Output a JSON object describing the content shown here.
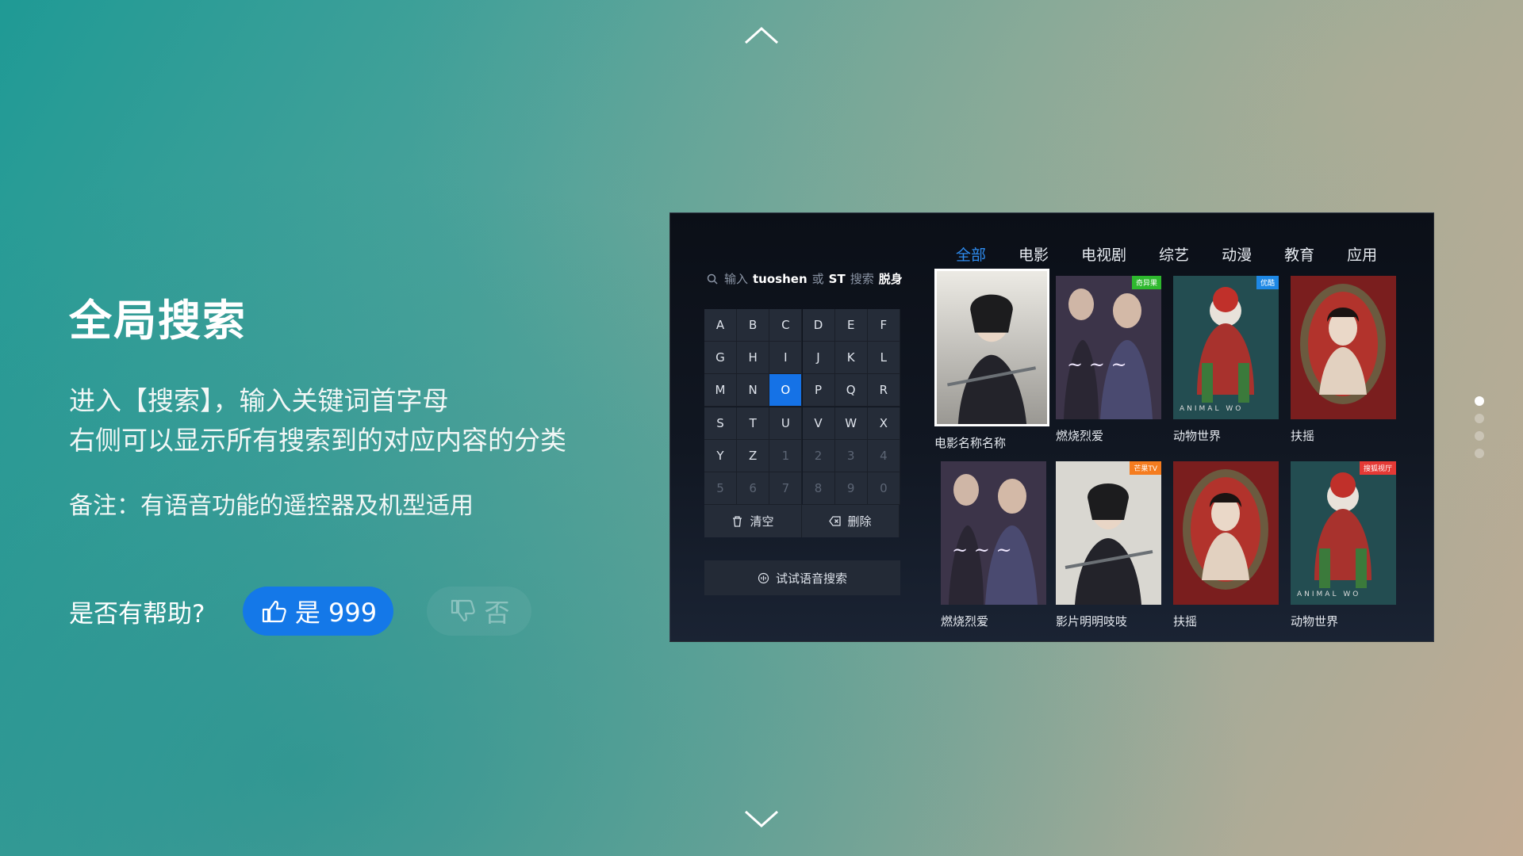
{
  "nav": {
    "up_icon": "chevron-up-icon",
    "down_icon": "chevron-down-icon"
  },
  "feature": {
    "title": "全局搜索",
    "desc_line1": "进入【搜索】，输入关键词首字母",
    "desc_line2": "右侧可以显示所有搜索到的对应内容的分类",
    "note": "备注：有语音功能的遥控器及机型适用"
  },
  "feedback": {
    "question": "是否有帮助?",
    "yes_label": "是 999",
    "no_label": "否"
  },
  "screen": {
    "tabs": [
      "全部",
      "电影",
      "电视剧",
      "综艺",
      "动漫",
      "教育",
      "应用"
    ],
    "search": {
      "hint1": "输入",
      "kw1": "tuoshen",
      "or": "或",
      "kw2": "ST",
      "hint2": "搜索",
      "target": "脱身"
    },
    "keyboard": [
      [
        "A",
        "B",
        "C",
        "D",
        "E",
        "F"
      ],
      [
        "G",
        "H",
        "I",
        "J",
        "K",
        "L"
      ],
      [
        "M",
        "N",
        "O",
        "P",
        "Q",
        "R"
      ],
      [
        "S",
        "T",
        "U",
        "V",
        "W",
        "X"
      ],
      [
        "Y",
        "Z",
        "1",
        "2",
        "3",
        "4"
      ],
      [
        "5",
        "6",
        "7",
        "8",
        "9",
        "0"
      ]
    ],
    "clear_label": "清空",
    "delete_label": "删除",
    "voice_label": "试试语音搜索",
    "posters": [
      {
        "caption": "电影名称名称",
        "badge": ""
      },
      {
        "caption": "燃烧烈爱",
        "badge": "奇异果"
      },
      {
        "caption": "动物世界",
        "badge": "优酷"
      },
      {
        "caption": "扶摇",
        "badge": ""
      },
      {
        "caption": "燃烧烈爱",
        "badge": ""
      },
      {
        "caption": "影片明明吱吱",
        "badge": "芒果TV"
      },
      {
        "caption": "扶摇",
        "badge": ""
      },
      {
        "caption": "动物世界",
        "badge": "搜狐视厅"
      }
    ]
  },
  "colors": {
    "accent": "#1478e8",
    "tab_active": "#2e8cf0",
    "badge_green": "#2eb82e",
    "badge_blue": "#1e88e5",
    "badge_orange": "#f57c1f",
    "badge_red": "#e53935"
  }
}
